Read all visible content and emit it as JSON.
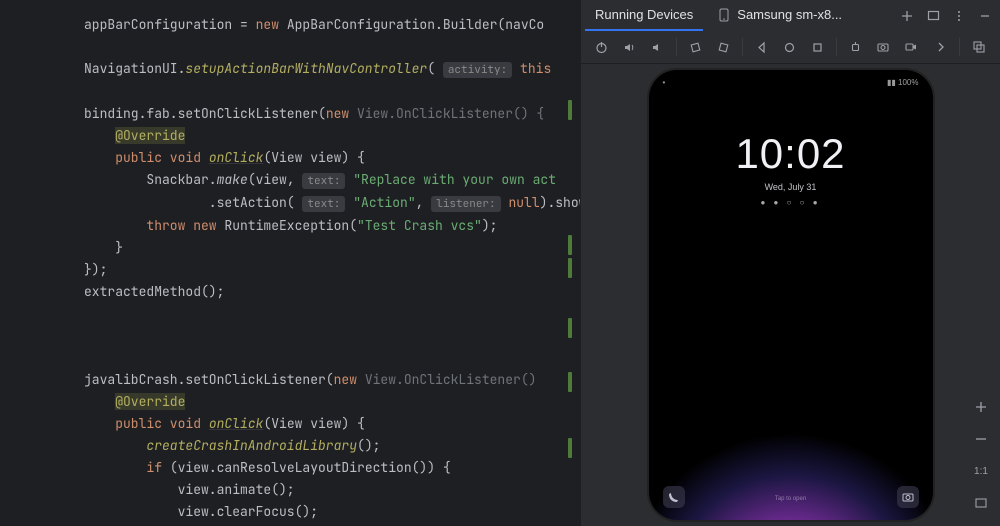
{
  "code": {
    "l1_a": "appBarConfiguration = ",
    "l1_b": "new",
    "l1_c": " AppBarConfiguration.Builder(navCo",
    "l3_a": "NavigationUI.",
    "l3_b": "setupActionBarWithNavController",
    "l3_c": "( ",
    "l3_hint": "activity:",
    "l3_d": " ",
    "l3_e": "this",
    "l5_a": "binding.fab.setOnClickListener(",
    "l5_b": "new",
    "l5_c": " View.OnClickListener() {",
    "l6_a": "    ",
    "l6_b": "@Override",
    "l7_a": "    ",
    "l7_b": "public void",
    "l7_c": " ",
    "l7_d": "onClick",
    "l7_e": "(View view) {",
    "l8_a": "        Snackbar.",
    "l8_b": "make",
    "l8_c": "(view, ",
    "l8_hint": "text:",
    "l8_d": " ",
    "l8_e": "\"Replace with your own act",
    "l9_a": "                .setAction( ",
    "l9_hint": "text:",
    "l9_b": " ",
    "l9_c": "\"Action\"",
    "l9_d": ", ",
    "l9_hint2": "listener:",
    "l9_e": " ",
    "l9_f": "null",
    "l9_g": ").show",
    "l10_a": "        ",
    "l10_b": "throw new",
    "l10_c": " RuntimeException(",
    "l10_d": "\"Test Crash vcs\"",
    "l10_e": ");",
    "l11": "    }",
    "l12": "});",
    "l13": "extractedMethod();",
    "l17_a": "javalibCrash.setOnClickListener(",
    "l17_b": "new",
    "l17_c": " View.OnClickListener()",
    "l18_a": "    ",
    "l18_b": "@Override",
    "l19_a": "    ",
    "l19_b": "public void",
    "l19_c": " ",
    "l19_d": "onClick",
    "l19_e": "(View view) {",
    "l20_a": "        ",
    "l20_b": "createCrashInAndroidLibrary",
    "l20_c": "();",
    "l21_a": "        ",
    "l21_b": "if",
    "l21_c": " (view.canResolveLayoutDirection()) {",
    "l22": "            view.animate();",
    "l23": "            view.clearFocus();"
  },
  "toolwindow": {
    "tab1": "Running Devices",
    "tab2": "Samsung sm-x8..."
  },
  "device": {
    "clock": "10:02",
    "date": "Wed, July 31",
    "indicators": "● ● ○ ○ ●",
    "bottom_text": "Tap to open"
  },
  "edge": {
    "ratio": "1:1"
  }
}
